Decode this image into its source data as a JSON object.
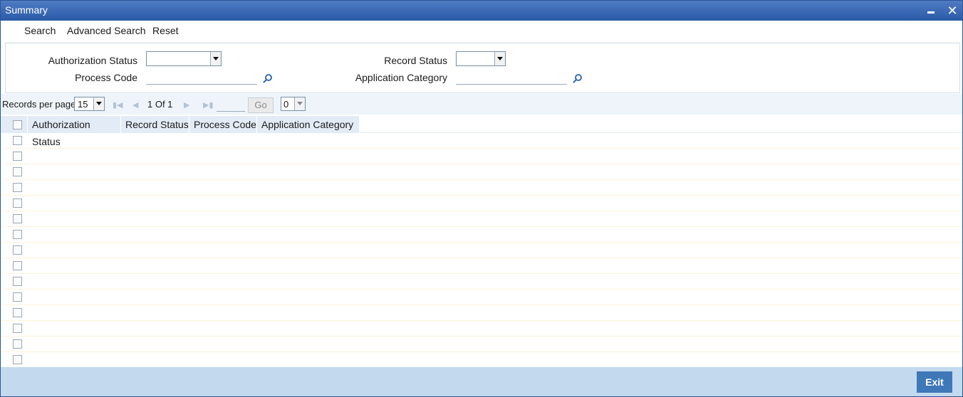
{
  "window": {
    "title": "Summary",
    "minimize_icon": "minimize-icon",
    "close_icon": "close-icon",
    "close_glyph": "✕"
  },
  "menu": {
    "items": [
      "Search",
      "Advanced Search",
      "Reset"
    ]
  },
  "criteria": {
    "authorization_status_label": "Authorization Status",
    "authorization_status_value": "",
    "record_status_label": "Record Status",
    "record_status_value": "",
    "process_code_label": "Process Code",
    "process_code_value": "",
    "application_category_label": "Application Category",
    "application_category_value": "",
    "lookup_icon": "search-icon"
  },
  "pager": {
    "records_per_page_label": "Records per page",
    "records_per_page_value": "15",
    "page_info": "1 Of 1",
    "go_label": "Go",
    "page_input_value": "",
    "zoom_value": "0"
  },
  "grid": {
    "columns": [
      "Authorization Status",
      "Record Status",
      "Process Code",
      "Application Category"
    ],
    "row_count": 15
  },
  "footer": {
    "exit_label": "Exit"
  },
  "colors": {
    "titlebar": "#2a5aa8",
    "header_bg": "#e3ecf6",
    "footer_bg": "#c3d9ee",
    "exit_button": "#3f78b8"
  }
}
